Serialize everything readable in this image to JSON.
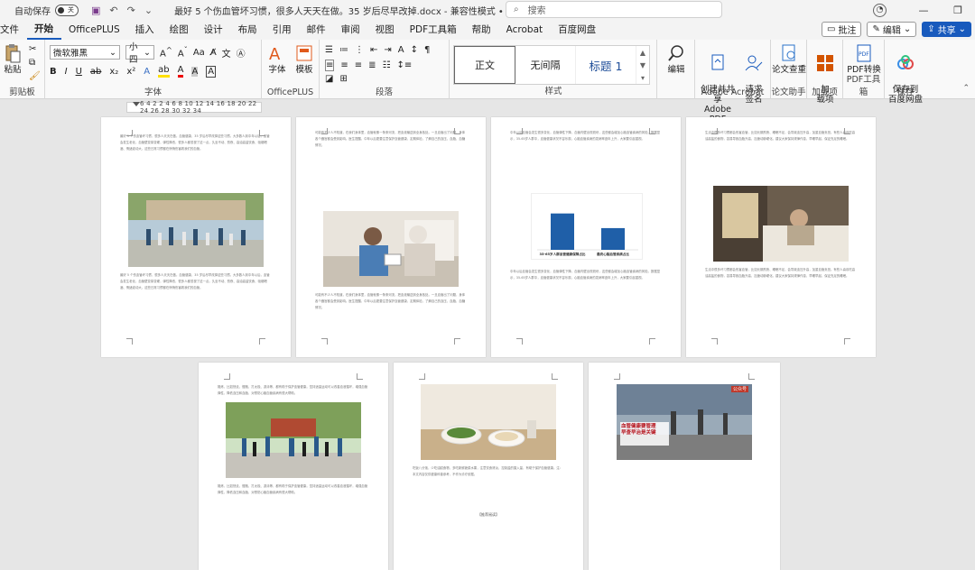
{
  "titlebar": {
    "autosave_label": "自动保存",
    "autosave_state": "关",
    "doc_title": "最好 5 个伤血管坏习惯，很多人天天在做。35 岁后尽早改掉.docx - 兼容性模式 • 已保存 ∨",
    "search_placeholder": "搜索"
  },
  "menu": {
    "tabs": [
      "文件",
      "开始",
      "OfficePLUS",
      "插入",
      "绘图",
      "设计",
      "布局",
      "引用",
      "邮件",
      "审阅",
      "视图",
      "PDF工具箱",
      "帮助",
      "Acrobat",
      "百度网盘"
    ],
    "active": "开始",
    "comment_btn": "批注",
    "edit_btn": "编辑",
    "share_btn": "共享"
  },
  "ribbon": {
    "clipboard": {
      "paste": "粘贴",
      "label": "剪贴板"
    },
    "font": {
      "name": "微软雅黑",
      "size": "小四",
      "label": "字体"
    },
    "officeplus": {
      "font_btn": "字体",
      "template_btn": "模板",
      "label": "OfficePLUS"
    },
    "paragraph": {
      "label": "段落"
    },
    "styles": {
      "items": [
        "正文",
        "无间隔",
        "标题 1"
      ],
      "label": "样式"
    },
    "editing": {
      "btn": "编辑"
    },
    "acrobat": {
      "create_share": "创建并共享\nAdobe PDF",
      "request_sign": "请求\n签名",
      "label": "Adobe Acrobat"
    },
    "paper": {
      "btn": "论文查重",
      "label": "论文助手"
    },
    "addins": {
      "btn": "加\n载项",
      "label": "加载项"
    },
    "pdf": {
      "btn": "PDF转换",
      "label": "PDF工具箱"
    },
    "save": {
      "btn": "保存到\n百度网盘",
      "label": "保存"
    }
  },
  "ruler": {
    "ticks": "6 4 2   2 4 6 8 10 12 14 16 18 20 22 24 26 28 30 32 34"
  },
  "chart": {
    "chart_data": {
      "type": "bar",
      "categories": [
        "35-65岁人群血管健康保障占比",
        "最终心脑血管疾病占比"
      ],
      "values": [
        72,
        43
      ],
      "ylim": [
        0,
        100
      ]
    }
  },
  "pages": {
    "p1_text": "最好 5 个伤血管坏习惯，很多人天天在做。血管健康，35 岁后尽早改掉这些习惯。大多数人到中年以后，血管会发生老化，血管壁变厚变硬，弹性降低，很多人都忽视了这一点。久坐不动、熬夜、高油高盐饮食、吸烟喝酒、情绪波动大，这些日常习惯都在悄悄伤害着我们的血管。",
    "p2_text": "可能有不少人不知道，在我们身体里，血管就像一条条河流，把血液输送到全身各处。一旦血管出了问题，身体各个器官都会受到影响。医生提醒，中年以后更要注意保护血管健康，定期体检，了解自己的血压、血脂、血糖情况。",
    "p3_text": "中年以后血管会发生很多变化，血管弹性下降，血管内壁出现斑块，这些都会增加心脑血管疾病的风险。数据显示，35-65岁人群中，血管健康状况不容乐观，心脑血管疾病的发病率逐年上升，大家要引起重视。",
    "p4_text": "生活中很多坏习惯都会伤害血管，比如长期熬夜、睡眠不足，会导致血压升高，加重血管负担。有些人喜欢吃高油高盐的食物，容易导致血脂升高，加速动脉硬化。建议大家保持规律作息，早睡早起，保证充足的睡眠。",
    "p5_text": "锻炼，比如快走、慢跑、打太极、游泳等，都有助于保护血管健康。坚持适量运动可以改善血液循环，增强血管弹性，降低血压和血脂，对预防心脑血管疾病有很大帮助。",
    "p6_text": "吃饭八分饱，少吃油腻食物，多吃新鲜蔬菜水果，注意饮食清淡，控制盐的摄入量，有助于保护血管健康。注：本文内容仅供健康科普参考，不作为诊疗依据。",
    "p6_footer": "【推荐阅读】",
    "p7_logo": "公众号",
    "p7_caption": "血管健康要管理\n早查早治是关键"
  }
}
